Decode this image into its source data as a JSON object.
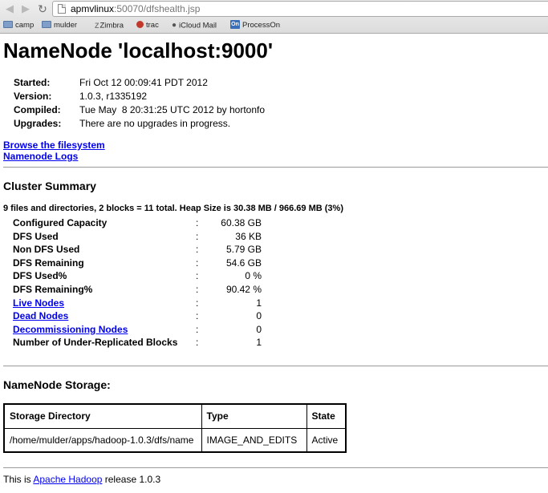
{
  "browser": {
    "url_host": "apmvlinux",
    "url_path": ":50070/dfshealth.jsp",
    "bookmarks": [
      {
        "label": "camp",
        "icon": "folder-icon"
      },
      {
        "label": "mulder",
        "icon": "folder-icon"
      },
      {
        "label": "Zimbra",
        "icon": "zimbra-icon"
      },
      {
        "label": "trac",
        "icon": "trac-icon"
      },
      {
        "label": "iCloud Mail",
        "icon": "apple-icon"
      },
      {
        "label": "ProcessOn",
        "icon": "processon-icon"
      }
    ]
  },
  "page": {
    "title": "NameNode 'localhost:9000'",
    "info": [
      {
        "key": "Started:",
        "value": "Fri Oct 12 00:09:41 PDT 2012"
      },
      {
        "key": "Version:",
        "value": "1.0.3, r1335192"
      },
      {
        "key": "Compiled:",
        "value": "Tue May  8 20:31:25 UTC 2012 by hortonfo"
      },
      {
        "key": "Upgrades:",
        "value": "There are no upgrades in progress."
      }
    ],
    "links": {
      "browse": "Browse the filesystem",
      "logs": "Namenode Logs"
    },
    "cluster_summary": {
      "heading": "Cluster Summary",
      "summary_line": "9 files and directories, 2 blocks = 11 total. Heap Size is 30.38 MB / 966.69 MB (3%)",
      "colon": ":",
      "rows": [
        {
          "label": "Configured Capacity",
          "value": "60.38 GB"
        },
        {
          "label": "DFS Used",
          "value": "36 KB"
        },
        {
          "label": "Non DFS Used",
          "value": "5.79 GB"
        },
        {
          "label": "DFS Remaining",
          "value": "54.6 GB"
        },
        {
          "label": "DFS Used%",
          "value": "0 %"
        },
        {
          "label": "DFS Remaining%",
          "value": "90.42 %"
        },
        {
          "label": "Live Nodes",
          "value": "1"
        },
        {
          "label": "Dead Nodes",
          "value": "0"
        },
        {
          "label": "Decommissioning Nodes",
          "value": "0"
        },
        {
          "label": "Number of Under-Replicated Blocks",
          "value": "1"
        }
      ]
    },
    "storage": {
      "heading": "NameNode Storage:",
      "columns": [
        "Storage Directory",
        "Type",
        "State"
      ],
      "rows": [
        [
          "/home/mulder/apps/hadoop-1.0.3/dfs/name",
          "IMAGE_AND_EDITS",
          "Active"
        ]
      ]
    },
    "footer": {
      "prefix": "This is",
      "link": "Apache Hadoop",
      "suffix": "release 1.0.3"
    }
  }
}
